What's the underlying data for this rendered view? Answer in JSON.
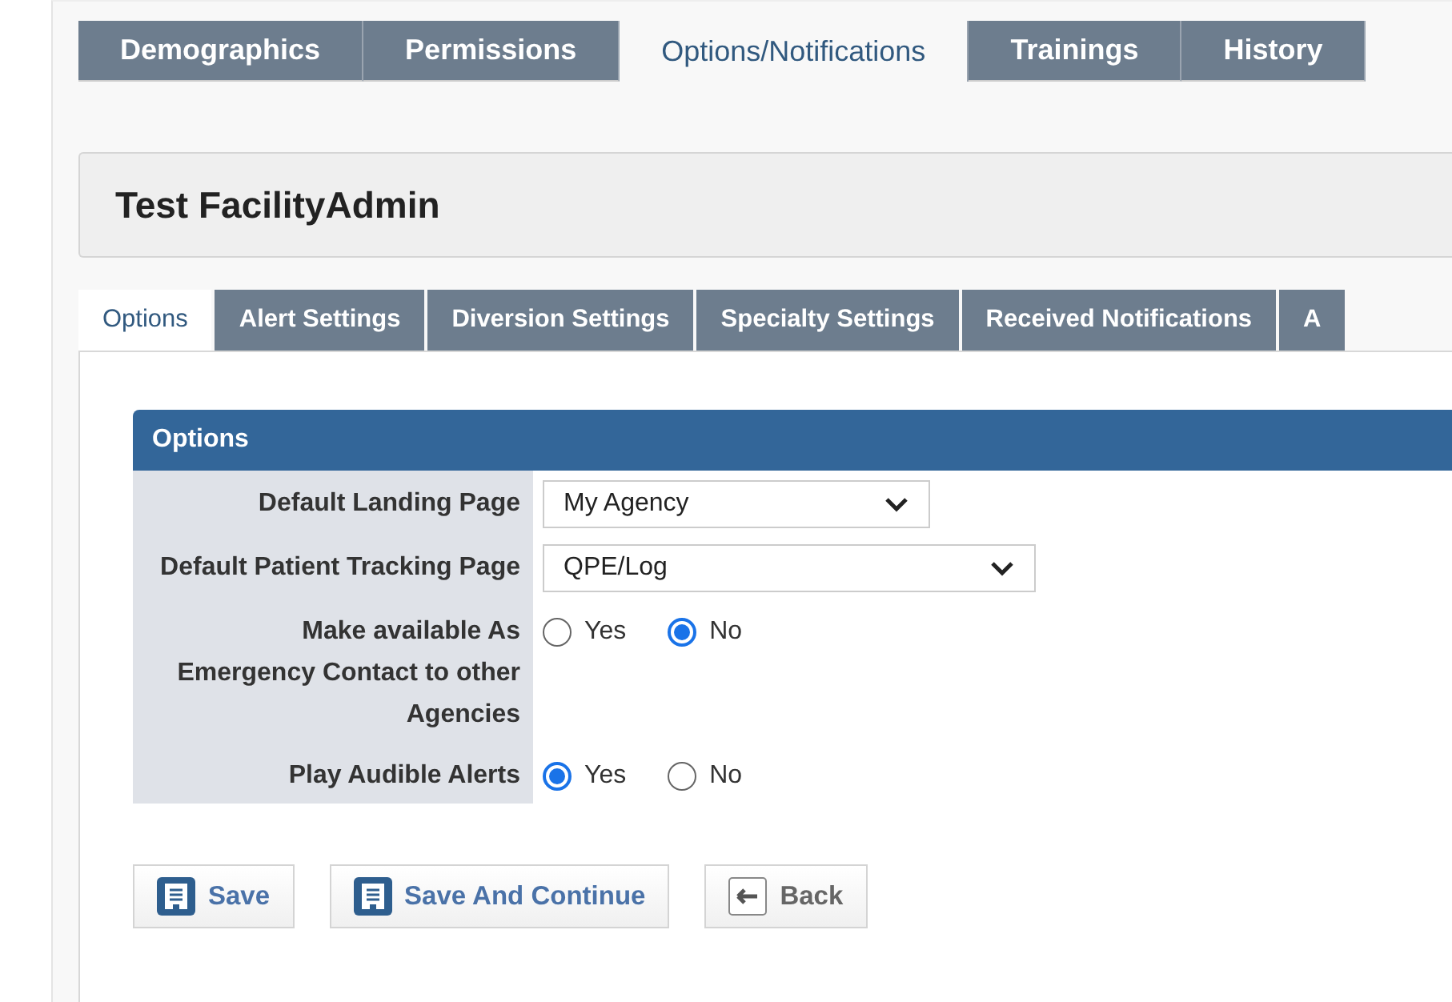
{
  "main_tabs": [
    {
      "label": "Demographics",
      "selected": false
    },
    {
      "label": "Permissions",
      "selected": false
    },
    {
      "label": "Options/Notifications",
      "selected": true
    },
    {
      "label": "Trainings",
      "selected": false
    },
    {
      "label": "History",
      "selected": false
    }
  ],
  "page_title": "Test FacilityAdmin",
  "sub_tabs": [
    {
      "label": "Options",
      "selected": true
    },
    {
      "label": "Alert Settings",
      "selected": false
    },
    {
      "label": "Diversion Settings",
      "selected": false
    },
    {
      "label": "Specialty Settings",
      "selected": false
    },
    {
      "label": "Received Notifications",
      "selected": false
    },
    {
      "label": "A",
      "selected": false
    }
  ],
  "section": {
    "title": "Options",
    "rows": [
      {
        "kind": "select",
        "label": "Default Landing Page",
        "value": "My Agency",
        "wide": false
      },
      {
        "kind": "select",
        "label": "Default Patient Tracking Page",
        "value": "QPE/Log",
        "wide": true
      },
      {
        "kind": "radio",
        "label": "Make available As Emergency Contact to other Agencies",
        "options": [
          {
            "label": "Yes",
            "selected": false
          },
          {
            "label": "No",
            "selected": true
          }
        ]
      },
      {
        "kind": "radio",
        "label": "Play Audible Alerts",
        "options": [
          {
            "label": "Yes",
            "selected": true
          },
          {
            "label": "No",
            "selected": false
          }
        ]
      }
    ]
  },
  "buttons": [
    {
      "label": "Save",
      "kind": "save"
    },
    {
      "label": "Save And Continue",
      "kind": "save"
    },
    {
      "label": "Back",
      "kind": "back"
    }
  ]
}
